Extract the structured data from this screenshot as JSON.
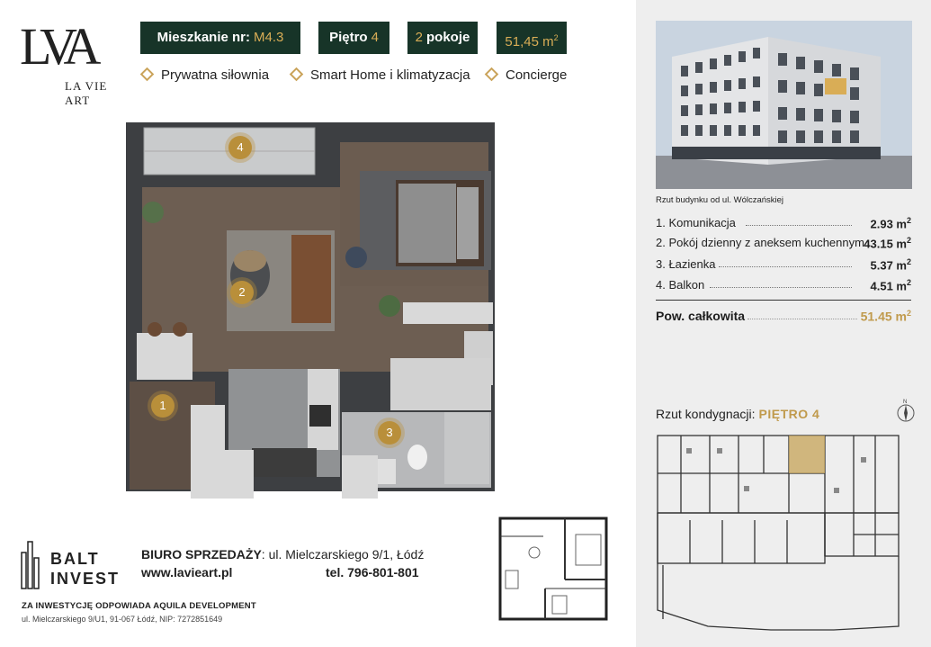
{
  "brand": {
    "logo_text": "LA VIE ART"
  },
  "badges": {
    "apartment_label": "Mieszkanie nr:",
    "apartment_value": "M4.3",
    "floor_label": "Piętro",
    "floor_value": "4",
    "rooms_value": "2",
    "rooms_label": "pokoje",
    "area_value": "51,45 m",
    "area_sup": "2"
  },
  "features": [
    "Prywatna siłownia",
    "Smart Home i klimatyzacja",
    "Concierge"
  ],
  "plan_markers": [
    "1",
    "2",
    "3",
    "4"
  ],
  "developer": {
    "name_line1": "BALT",
    "name_line2": "INVEST"
  },
  "office": {
    "label": "BIURO SPRZEDAŻY",
    "address": ": ul. Mielczarskiego 9/1, Łódź",
    "website": "www.lavieart.pl",
    "phone": "tel. 796-801-801"
  },
  "legal": {
    "investor": "ZA INWESTYCJĘ ODPOWIADA AQUILA DEVELOPMENT",
    "address": "ul. Mielczarskiego 9/U1, 91-067 Łódź, NIP: 7272851649"
  },
  "building_caption": "Rzut budynku od ul. Wólczańskiej",
  "rooms": [
    {
      "label": "1. Komunikacja",
      "value": "2.93 m",
      "sup": "2"
    },
    {
      "label": "2. Pokój dzienny z aneksem kuchennym",
      "value": "43.15 m",
      "sup": "2"
    },
    {
      "label": "3. Łazienka",
      "value": "5.37 m",
      "sup": "2"
    },
    {
      "label": "4. Balkon",
      "value": "4.51 m",
      "sup": "2"
    }
  ],
  "total": {
    "label": "Pow. całkowita",
    "value": "51.45 m",
    "sup": "2"
  },
  "floor_plan": {
    "label": "Rzut kondygnacji:",
    "value": "PIĘTRO 4"
  },
  "colors": {
    "badge_bg": "#173428",
    "gold": "#c09a4c",
    "right_bg": "#eeeeee"
  }
}
